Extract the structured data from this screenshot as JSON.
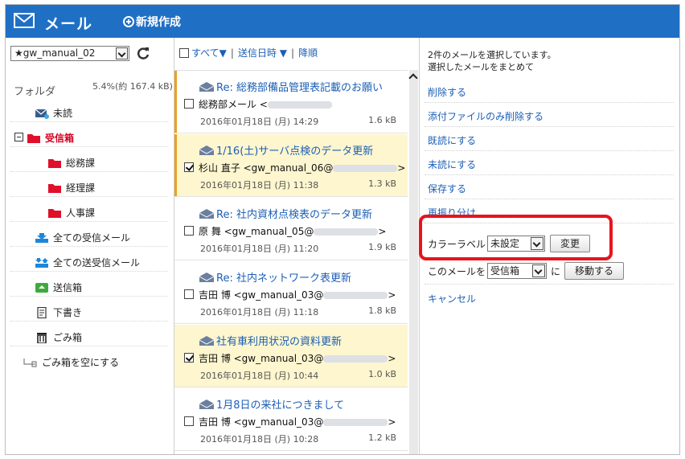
{
  "header": {
    "title": "メール",
    "compose": "新規作成"
  },
  "sidebar": {
    "account": "★gw_manual_02",
    "folder_heading": "フォルダ",
    "quota": "5.4%(約 167.4 kB)",
    "items": [
      {
        "label": "未読"
      },
      {
        "label": "受信箱"
      },
      {
        "label": "総務課"
      },
      {
        "label": "経理課"
      },
      {
        "label": "人事課"
      },
      {
        "label": "全ての受信メール"
      },
      {
        "label": "全ての送受信メール"
      },
      {
        "label": "送信箱"
      },
      {
        "label": "下書き"
      },
      {
        "label": "ごみ箱"
      },
      {
        "label": "ごみ箱を空にする"
      }
    ]
  },
  "list": {
    "select_all": "すべて▼",
    "sort": "送信日時 ▼",
    "order": "降順",
    "sep": "|",
    "messages": [
      {
        "subject": "Re: 総務部備品管理表記載のお願い",
        "from": "総務部メール <",
        "from_end": "",
        "date": "2016年01月18日 (月) 14:29",
        "size": "1.6 kB"
      },
      {
        "subject": "1/16(土)サーバ点検のデータ更新",
        "from": "杉山 直子 <gw_manual_06@",
        "from_end": ">",
        "date": "2016年01月18日 (月) 11:38",
        "size": "1.3 kB"
      },
      {
        "subject": "Re: 社内資材点検表のデータ更新",
        "from": "原 舞 <gw_manual_05@",
        "from_end": ">",
        "date": "2016年01月18日 (月) 11:20",
        "size": "1.9 kB"
      },
      {
        "subject": "Re: 社内ネットワーク表更新",
        "from": "吉田 博 <gw_manual_03@",
        "from_end": ">",
        "date": "2016年01月18日 (月) 11:18",
        "size": "1.8 kB"
      },
      {
        "subject": "社有車利用状況の資料更新",
        "from": "吉田 博 <gw_manual_03@",
        "from_end": ">",
        "date": "2016年01月18日 (月) 10:44",
        "size": "1.0 kB"
      },
      {
        "subject": "1月8日の来社につきまして",
        "from": "吉田 博 <gw_manual_03@",
        "from_end": ">",
        "date": "2016年01月18日 (月) 10:28",
        "size": "1.2 kB"
      }
    ]
  },
  "panel": {
    "info1": "2件のメールを選択しています。",
    "info2": "選択したメールをまとめて",
    "actions": [
      "削除する",
      "添付ファイルのみ削除する",
      "既読にする",
      "未読にする",
      "保存する",
      "再振り分け"
    ],
    "color_label": "カラーラベル",
    "color_value": "未設定",
    "change_btn": "変更",
    "move_prefix": "このメールを",
    "move_value": "受信箱",
    "move_ni": "に",
    "move_btn": "移動する",
    "cancel": "キャンセル"
  },
  "colors": {
    "header": "#1f6fc5",
    "link": "#1b5fb5",
    "accent_red": "#d4001f",
    "selected_row": "#fdf6cf",
    "highlight": "#e8141c"
  }
}
